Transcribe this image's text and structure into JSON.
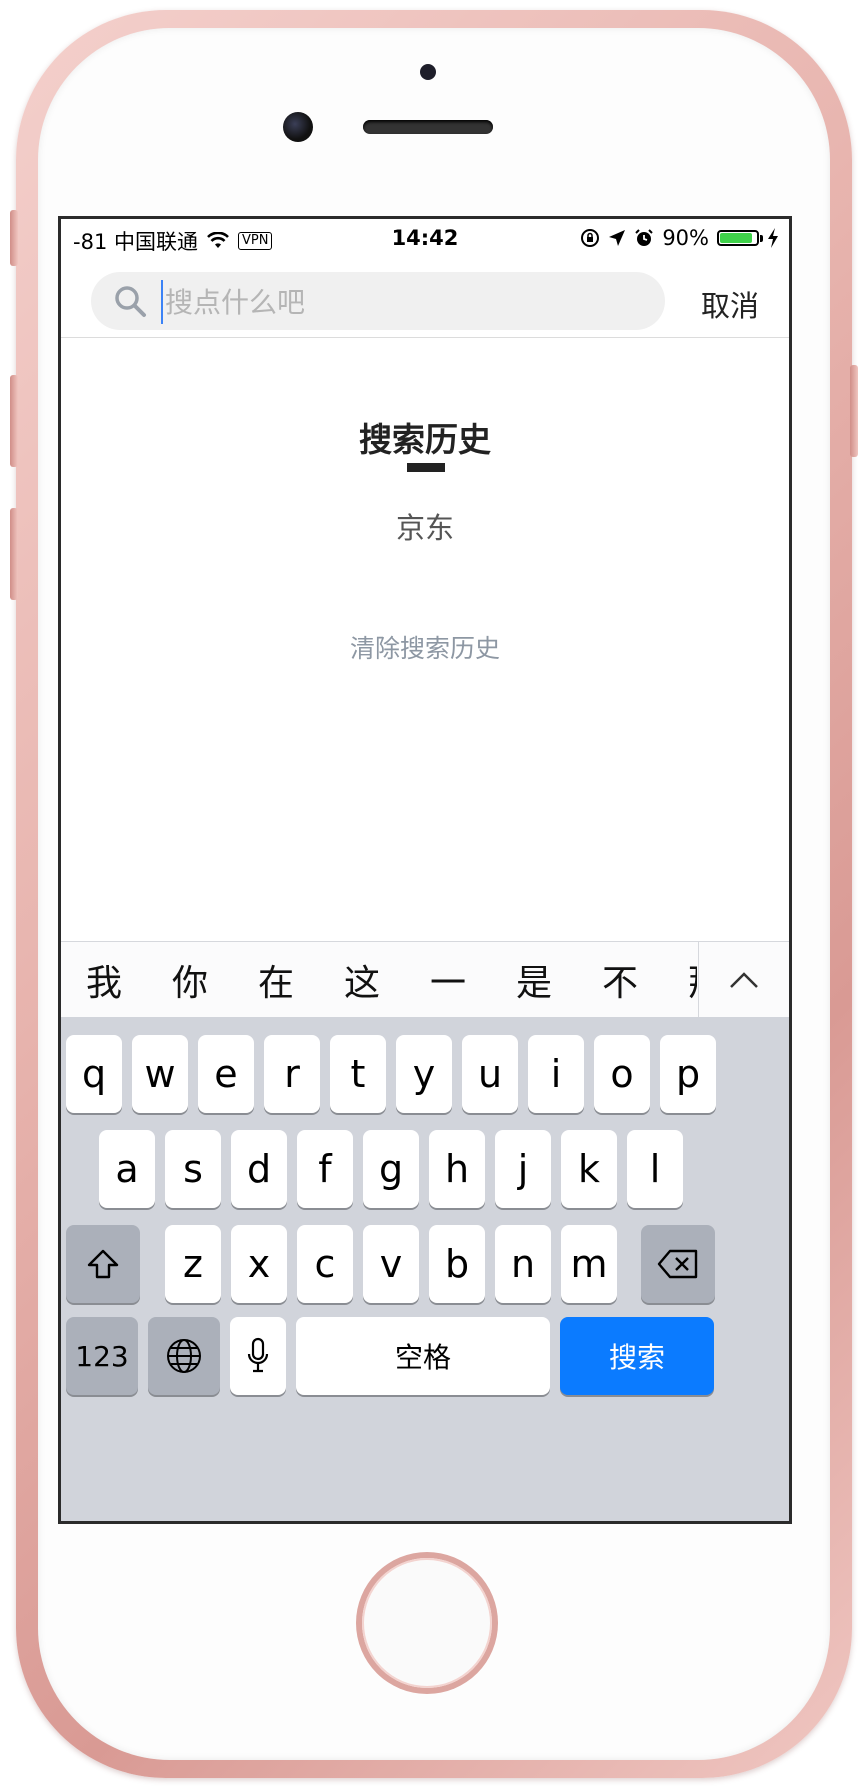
{
  "status_bar": {
    "carrier": "-81 中国联通",
    "vpn": "VPN",
    "time": "14:42",
    "battery_percent": "90%",
    "battery_level": 0.9
  },
  "search": {
    "placeholder": "搜点什么吧",
    "cancel_label": "取消"
  },
  "history": {
    "title": "搜索历史",
    "items": [
      "京东"
    ],
    "clear_label": "清除搜索历史"
  },
  "keyboard": {
    "candidates": [
      "我",
      "你",
      "在",
      "这",
      "一",
      "是",
      "不",
      "那"
    ],
    "row1": [
      "q",
      "w",
      "e",
      "r",
      "t",
      "y",
      "u",
      "i",
      "o",
      "p"
    ],
    "row2": [
      "a",
      "s",
      "d",
      "f",
      "g",
      "h",
      "j",
      "k",
      "l"
    ],
    "row3": [
      "z",
      "x",
      "c",
      "v",
      "b",
      "n",
      "m"
    ],
    "numbers_label": "123",
    "space_label": "空格",
    "search_label": "搜索"
  },
  "colors": {
    "accent": "#0b7bff",
    "battery": "#3fd24a",
    "keyboard_bg": "#d1d4db"
  }
}
